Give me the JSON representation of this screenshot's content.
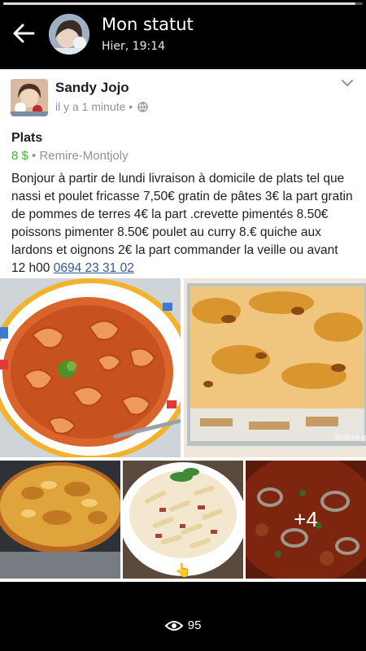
{
  "story": {
    "progress": 0.98
  },
  "header": {
    "title": "Mon statut",
    "time": "Hier, 19:14"
  },
  "post": {
    "author": "Sandy Jojo",
    "time": "il y a 1 minute",
    "meta_separator": "•",
    "product_title": "Plats",
    "price": "8 $",
    "location": "• Remire-Montjoly",
    "text": "Bonjour à partir de lundi livraison à domicile de plats tel que nassi et poulet fricasse 7,50€  gratin de pâtes 3€ la part  gratin de pommes de terres 4€ la part .crevette pimentés 8.50€ poissons pimenter 8.50€ poulet au curry 8.€ quiche aux lardons et oignons 2€ la part commander la veille ou avant 12 h00 ",
    "phone": "0694 23 31 02",
    "photos": [
      {
        "name": "shrimp-curry-photo"
      },
      {
        "name": "potato-gratin-photo",
        "watermark": "Binôme g"
      },
      {
        "name": "quiche-photo"
      },
      {
        "name": "pasta-gratin-photo"
      },
      {
        "name": "fish-stew-photo",
        "more": "+4"
      }
    ]
  },
  "footer": {
    "views": "95"
  },
  "colors": {
    "link": "#365899",
    "price": "#42b72a",
    "meta": "#8d949e"
  }
}
